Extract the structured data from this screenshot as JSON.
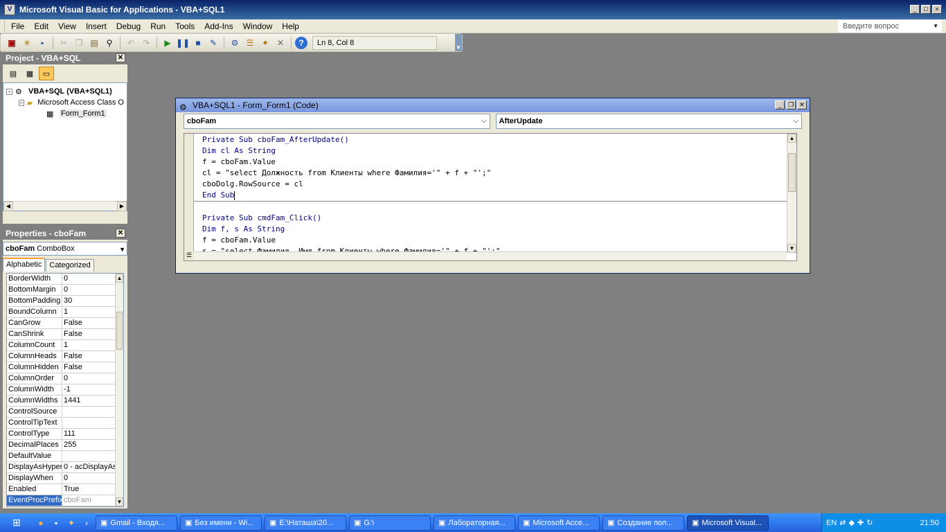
{
  "window": {
    "title": "Microsoft Visual Basic for Applications - VBA+SQL1",
    "controls": [
      "_",
      "□",
      "×"
    ]
  },
  "menu": {
    "items": [
      "File",
      "Edit",
      "View",
      "Insert",
      "Debug",
      "Run",
      "Tools",
      "Add-Ins",
      "Window",
      "Help"
    ],
    "help_box_placeholder": "Введите вопрос"
  },
  "toolbar": {
    "icons": [
      "access-icon",
      "insert-module-icon",
      "save-icon",
      "cut-icon",
      "copy-icon",
      "paste-icon",
      "find-icon",
      "undo-icon",
      "redo-icon",
      "run-icon",
      "break-icon",
      "reset-icon",
      "design-mode-icon",
      "project-explorer-icon",
      "properties-icon",
      "object-browser-icon",
      "toolbox-icon",
      "help-icon"
    ],
    "position_text": "Ln 8, Col 8"
  },
  "project": {
    "title": "Project - VBA+SQL",
    "tree": [
      {
        "label": "VBA+SQL (VBA+SQL1)",
        "level": 0,
        "toggle": "−",
        "bold": true
      },
      {
        "label": "Microsoft Access Class O",
        "level": 1,
        "toggle": "−",
        "bold": false
      },
      {
        "label": "Form_Form1",
        "level": 2,
        "toggle": "",
        "bold": false
      }
    ]
  },
  "properties": {
    "title": "Properties - cboFam",
    "object_name": "cboFam",
    "object_type": "ComboBox",
    "tabs": [
      "Alphabetic",
      "Categorized"
    ],
    "rows": [
      {
        "name": "BorderWidth",
        "value": "0"
      },
      {
        "name": "BottomMargin",
        "value": "0"
      },
      {
        "name": "BottomPadding",
        "value": "30"
      },
      {
        "name": "BoundColumn",
        "value": "1"
      },
      {
        "name": "CanGrow",
        "value": "False"
      },
      {
        "name": "CanShrink",
        "value": "False"
      },
      {
        "name": "ColumnCount",
        "value": "1"
      },
      {
        "name": "ColumnHeads",
        "value": "False"
      },
      {
        "name": "ColumnHidden",
        "value": "False"
      },
      {
        "name": "ColumnOrder",
        "value": "0"
      },
      {
        "name": "ColumnWidth",
        "value": "-1"
      },
      {
        "name": "ColumnWidths",
        "value": "1441"
      },
      {
        "name": "ControlSource",
        "value": ""
      },
      {
        "name": "ControlTipText",
        "value": ""
      },
      {
        "name": "ControlType",
        "value": "111"
      },
      {
        "name": "DecimalPlaces",
        "value": "255"
      },
      {
        "name": "DefaultValue",
        "value": ""
      },
      {
        "name": "DisplayAsHyperli",
        "value": "0 - acDisplayAs"
      },
      {
        "name": "DisplayWhen",
        "value": "0"
      },
      {
        "name": "Enabled",
        "value": "True"
      },
      {
        "name": "EventProcPrefix",
        "value": "cboFam"
      }
    ]
  },
  "code_window": {
    "title": "VBA+SQL1 - Form_Form1 (Code)",
    "object_combo": "cboFam",
    "procedure_combo": "AfterUpdate",
    "procedures": [
      [
        "Private Sub cboFam_AfterUpdate()",
        "Dim cl As String",
        "f = cboFam.Value",
        "cl = \"select Должность from Клиенты where Фамилия='\" + f + \"';\"",
        "cboDolg.RowSource = cl",
        "End Sub"
      ],
      [
        "Private Sub cmdFam_Click()",
        "Dim f, s As String",
        "f = cboFam.Value",
        "s = \"select Фамилия, Имя from Клиенты where Фамилия='\" + f + \"';\""
      ]
    ]
  },
  "taskbar": {
    "tasks": [
      {
        "label": "Gmail - Входя...",
        "icon": "chrome-icon",
        "active": false
      },
      {
        "label": "Без имени - Wi...",
        "icon": "paint-icon",
        "active": false
      },
      {
        "label": "E:\\Наташа\\20...",
        "icon": "folder-icon",
        "active": false
      },
      {
        "label": "G:\\",
        "icon": "drive-icon",
        "active": false
      },
      {
        "label": "Лабораторная...",
        "icon": "word-icon",
        "active": false
      },
      {
        "label": "Microsoft Acce...",
        "icon": "access-icon",
        "active": false
      },
      {
        "label": "Создание пол...",
        "icon": "word-icon",
        "active": false
      },
      {
        "label": "Microsoft Visual...",
        "icon": "vba-icon",
        "active": true
      }
    ],
    "language": "EN",
    "time": "21:50"
  }
}
